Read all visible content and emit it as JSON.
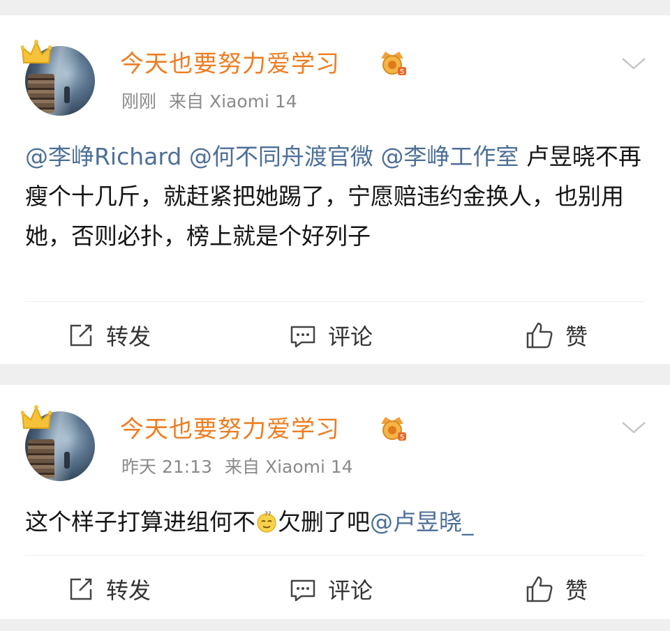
{
  "posts": [
    {
      "author": "今天也要努力爱学习",
      "time": "刚刚",
      "source": "来自 Xiaomi 14",
      "content": [
        {
          "type": "mention",
          "text": "@李峥Richard"
        },
        {
          "type": "text",
          "text": " "
        },
        {
          "type": "mention",
          "text": "@何不同舟渡官微"
        },
        {
          "type": "text",
          "text": " "
        },
        {
          "type": "mention",
          "text": "@李峥工作室"
        },
        {
          "type": "text",
          "text": " 卢昱晓不再瘦个十几斤，就赶紧把她踢了，宁愿赔违约金换人，也别用她，否则必扑，榜上就是个好列子"
        }
      ],
      "actions": {
        "repost": "转发",
        "comment": "评论",
        "like": "赞"
      }
    },
    {
      "author": "今天也要努力爱学习",
      "time": "昨天 21:13",
      "source": "来自 Xiaomi 14",
      "content_before_emoji": "这个样子打算进组何不",
      "emoji": "doubt-emoji",
      "content_after_emoji": "欠删了吧",
      "mention": "@卢昱晓_",
      "actions": {
        "repost": "转发",
        "comment": "评论",
        "like": "赞"
      }
    }
  ],
  "colors": {
    "author": "#ee7d22",
    "mention": "#4d6f97",
    "meta": "#8a8a8a",
    "background": "#efefef"
  },
  "icons": {
    "crown": "crown-icon",
    "vip": "vip-badge-icon",
    "more": "chevron-down-icon",
    "repost": "repost-icon",
    "comment": "comment-icon",
    "like": "thumbs-up-icon"
  }
}
